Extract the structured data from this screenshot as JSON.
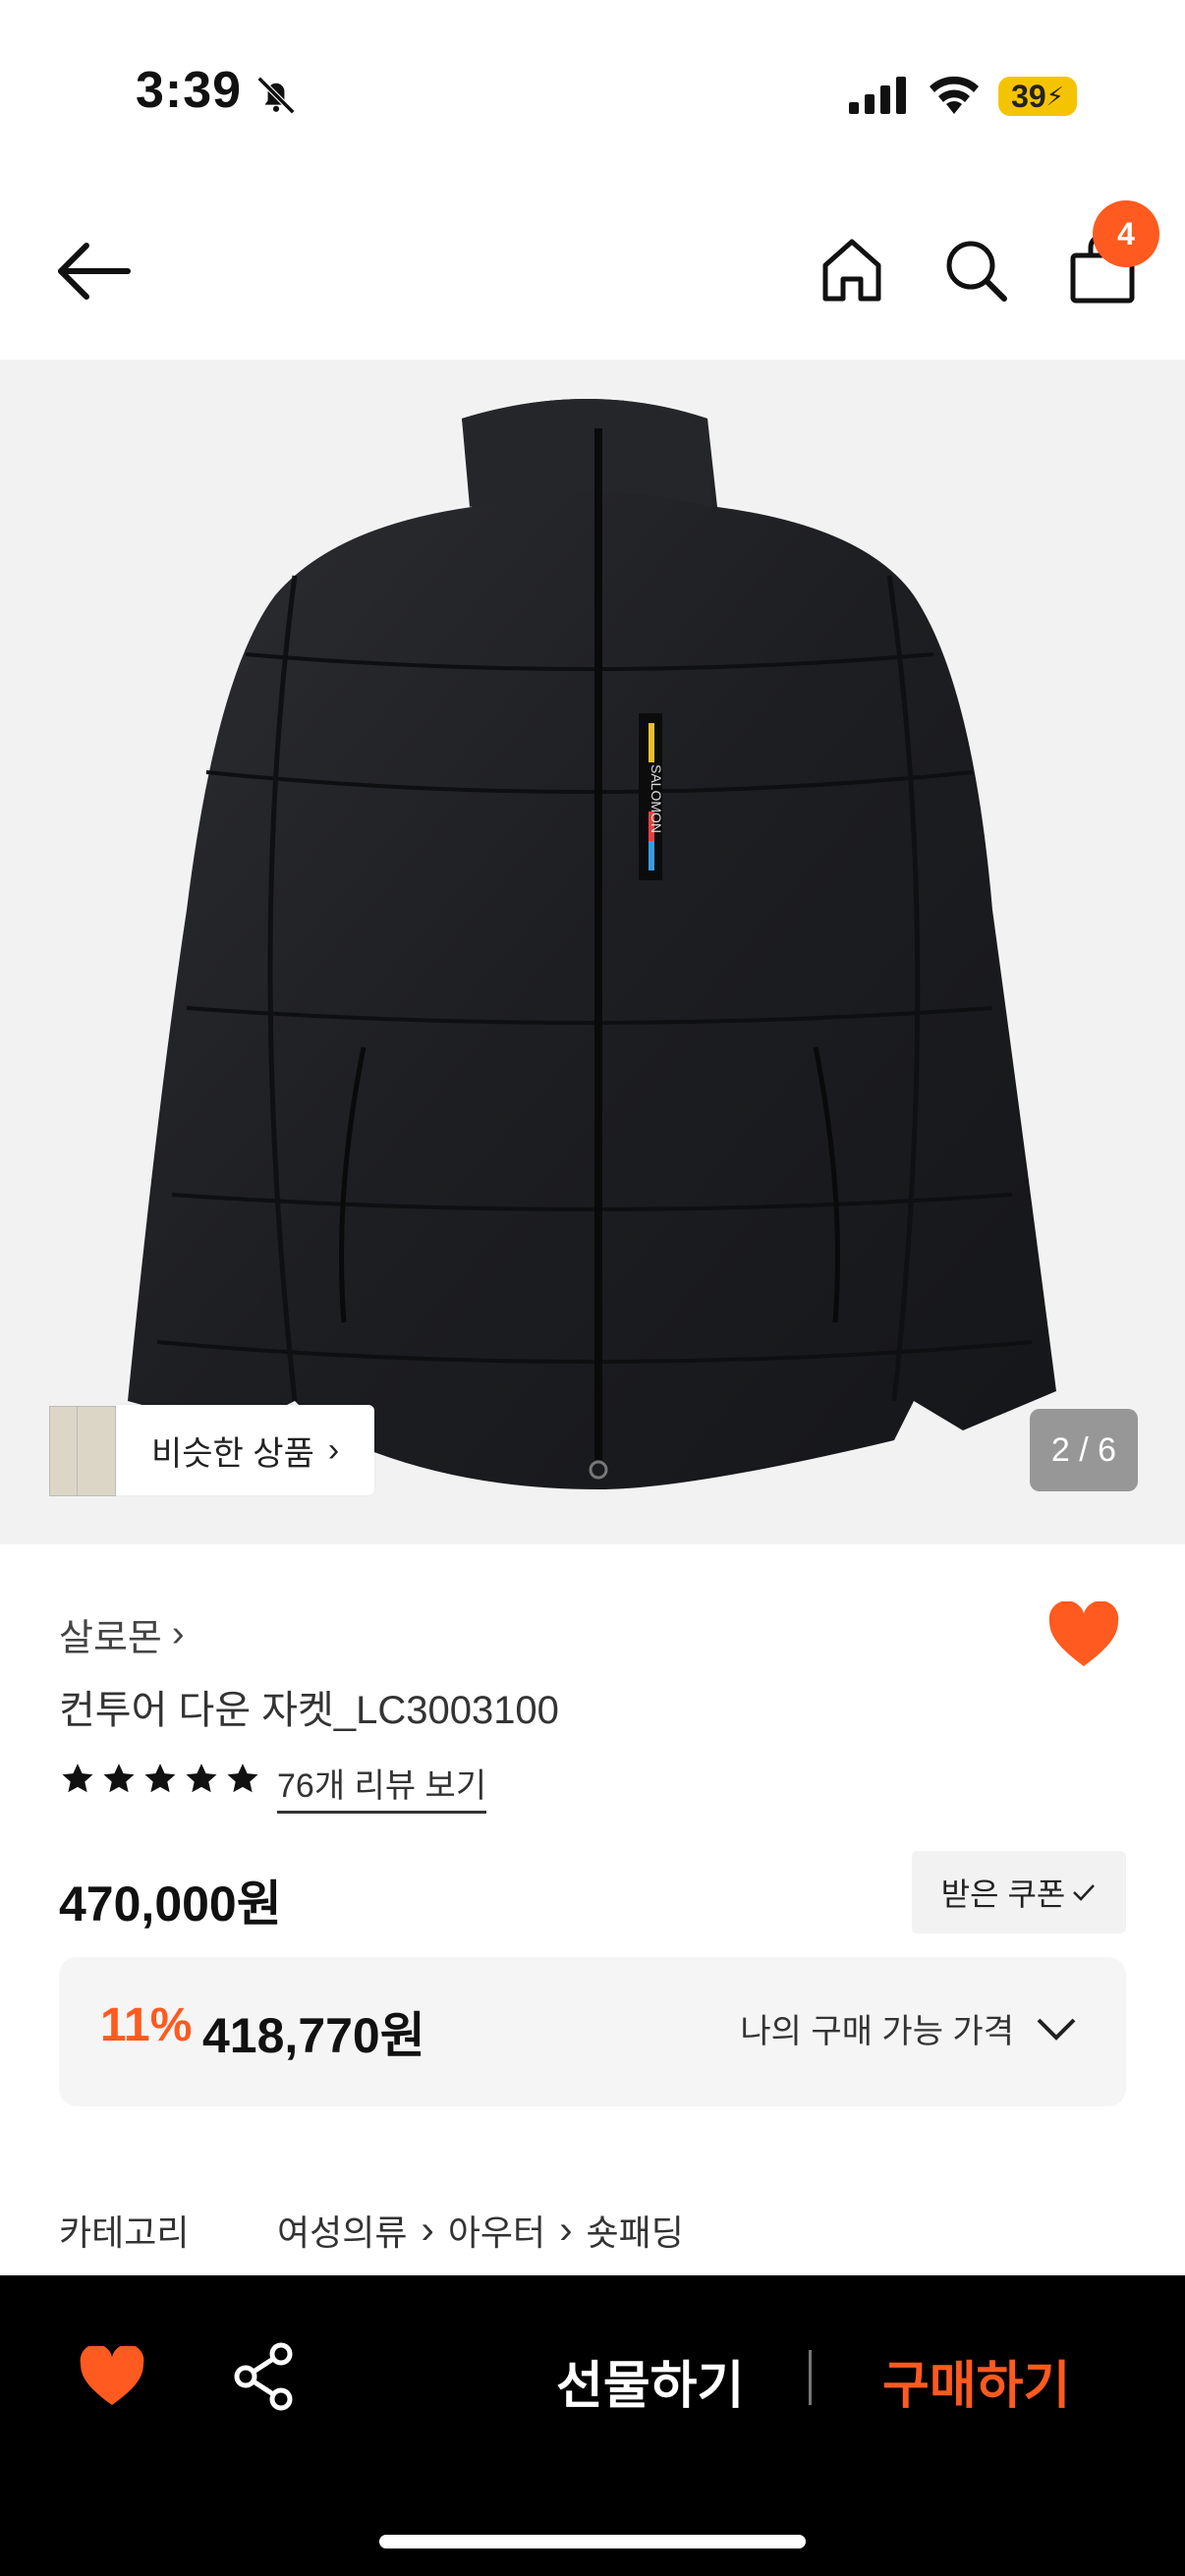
{
  "status_bar": {
    "time": "3:39",
    "battery": "39",
    "icons": [
      "bell-slash-icon",
      "signal-icon",
      "wifi-icon",
      "battery-icon"
    ]
  },
  "nav": {
    "cart_count": "4",
    "icons": [
      "back-arrow-icon",
      "home-icon",
      "search-icon",
      "shopping-bag-icon"
    ]
  },
  "hero": {
    "similar_label": "비슷한 상품",
    "page_indicator": "2 / 6",
    "logo_text": "SALOMON"
  },
  "product": {
    "brand": "살로몬",
    "title": "컨투어 다운 자켓_LC3003100",
    "rating_stars": 5,
    "review_link": "76개 리뷰 보기",
    "price": "470,000원",
    "coupon_label": "받은 쿠폰",
    "discount_rate": "11%",
    "discount_price": "418,770원",
    "my_price_label": "나의 구매 가능 가격"
  },
  "category": {
    "label": "카테고리",
    "path": [
      "여성의류",
      "아우터",
      "숏패딩"
    ]
  },
  "bottom_bar": {
    "gift_label": "선물하기",
    "buy_label": "구매하기"
  },
  "colors": {
    "accent": "#ff5a1f",
    "background": "#ffffff",
    "hero_bg": "#f2f2f2",
    "bottom_bar": "#000000"
  }
}
